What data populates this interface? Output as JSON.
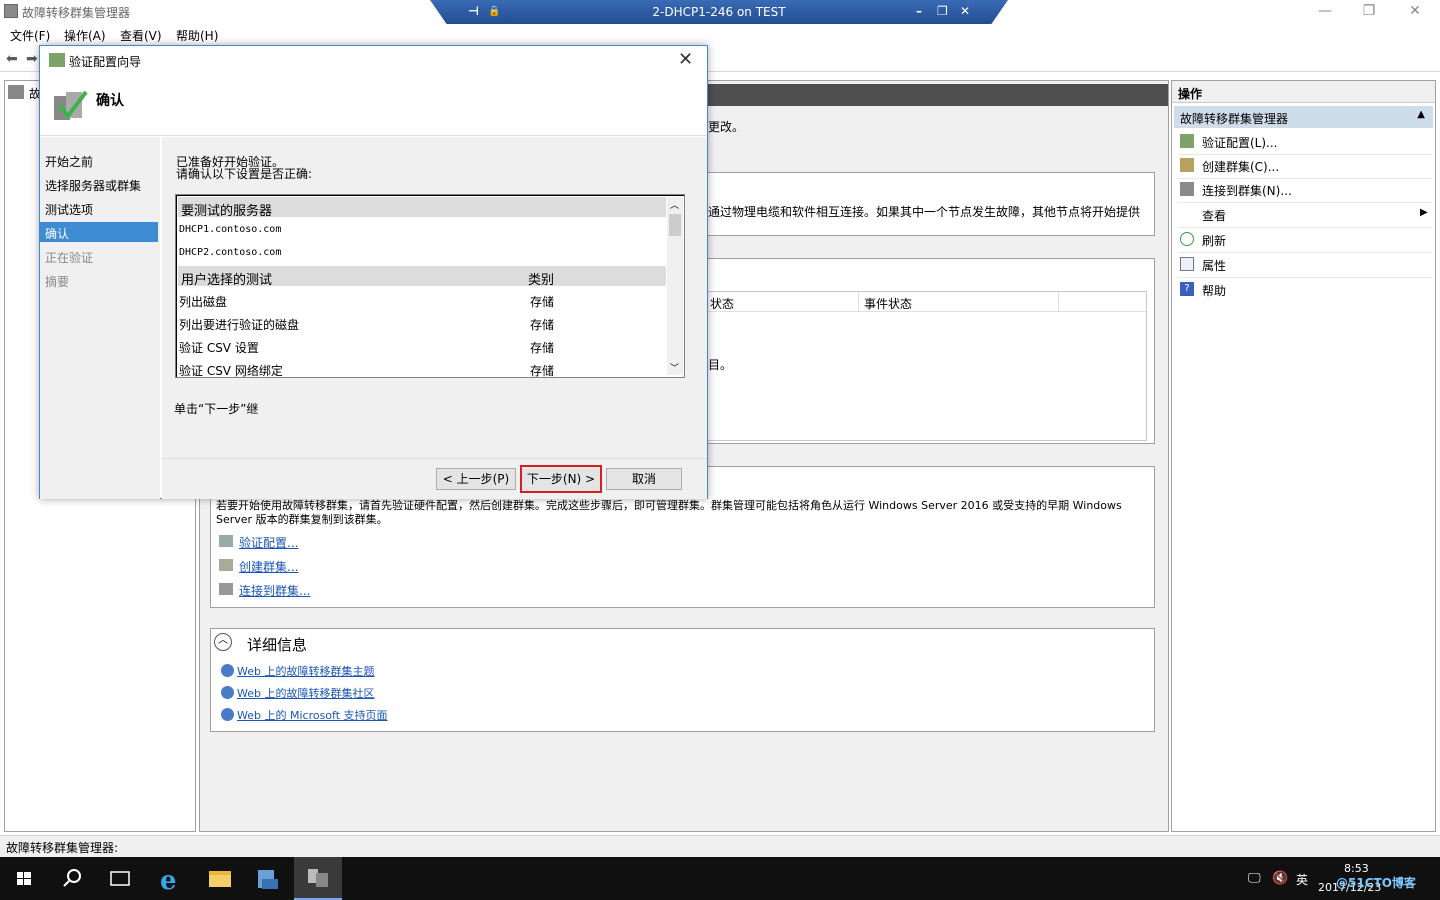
{
  "window": {
    "title": "故障转移群集管理器",
    "minimize": "—",
    "restore": "❐",
    "close": "✕"
  },
  "rdp": {
    "title": "2-DHCP1-246 on TEST",
    "pin": "⊣",
    "lock": "🔒",
    "minimize": "–",
    "restore": "❐",
    "close": "✕"
  },
  "menu": [
    "文件(F)",
    "操作(A)",
    "查看(V)",
    "帮助(H)"
  ],
  "tree": {
    "root_label": "故"
  },
  "center": {
    "partial_text_1": "更改。",
    "partial_text_2": "通过物理电缆和软件相互连接。如果其中一个节点发生故障，其他节点将开始提供",
    "col_status": "状态",
    "col_event_status": "事件状态",
    "partial_text_3": "目。",
    "create_desc": "若要开始使用故障转移群集，请首先验证硬件配置，然后创建群集。完成这些步骤后，即可管理群集。群集管理可能包括将角色从运行 Windows Server 2016 或受支持的早期 Windows Server 版本的群集复制到该群集。",
    "links": [
      "验证配置...",
      "创建群集...",
      "连接到群集..."
    ],
    "details_title": "详细信息",
    "web_links": [
      "Web 上的故障转移群集主题",
      "Web 上的故障转移群集社区",
      "Web 上的 Microsoft 支持页面"
    ],
    "collapse_glyph": "︿"
  },
  "actions": {
    "header": "操作",
    "section": "故障转移群集管理器",
    "items": [
      {
        "label": "验证配置(L)...",
        "icon": "validate-icon"
      },
      {
        "label": "创建群集(C)...",
        "icon": "create-cluster-icon"
      },
      {
        "label": "连接到群集(N)...",
        "icon": "connect-cluster-icon"
      },
      {
        "label": "查看",
        "icon": "view-icon"
      },
      {
        "label": "刷新",
        "icon": "refresh-icon"
      },
      {
        "label": "属性",
        "icon": "properties-icon"
      },
      {
        "label": "帮助",
        "icon": "help-icon"
      }
    ]
  },
  "wizard": {
    "title": "验证配置向导",
    "heading": "确认",
    "close": "✕",
    "steps": [
      {
        "label": "开始之前",
        "state": "normal"
      },
      {
        "label": "选择服务器或群集",
        "state": "normal"
      },
      {
        "label": "测试选项",
        "state": "normal"
      },
      {
        "label": "确认",
        "state": "active"
      },
      {
        "label": "正在验证",
        "state": "disabled"
      },
      {
        "label": "摘要",
        "state": "disabled"
      }
    ],
    "intro_line1": "已准备好开始验证。",
    "intro_line2": "请确认以下设置是否正确:",
    "servers_header": "要测试的服务器",
    "servers": [
      "DHCP1.contoso.com",
      "DHCP2.contoso.com"
    ],
    "tests_header": "用户选择的测试",
    "category_header": "类别",
    "tests": [
      {
        "name": "列出磁盘",
        "category": "存储"
      },
      {
        "name": "列出要进行验证的磁盘",
        "category": "存储"
      },
      {
        "name": "验证 CSV 设置",
        "category": "存储"
      },
      {
        "name": "验证 CSV 网络绑定",
        "category": "存储"
      }
    ],
    "footer_text": "单击“下一步”继",
    "buttons": {
      "back": "< 上一步(P)",
      "next": "下一步(N) >",
      "cancel": "取消"
    }
  },
  "statusbar": {
    "text": "故障转移群集管理器:"
  },
  "taskbar": {
    "tray_lang": "英",
    "time": "8:53",
    "date": "2017/12/23",
    "watermark": "@51CTO博客"
  },
  "colors": {
    "accent": "#3c8bd3",
    "highlight_border": "#d32020",
    "link": "#1a56b5",
    "taskbar": "#101010"
  }
}
